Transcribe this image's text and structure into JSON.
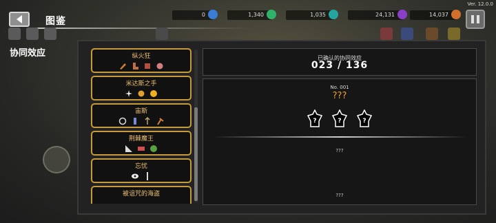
{
  "header": {
    "title": "图鉴",
    "version": "Ver. 12.0.0"
  },
  "resources": [
    {
      "name": "blue-gem",
      "value": "0",
      "color": "#3a7bd5"
    },
    {
      "name": "green-gem",
      "value": "1,340",
      "color": "#2fb36a"
    },
    {
      "name": "teal-gem",
      "value": "1,035",
      "color": "#23a6a0"
    },
    {
      "name": "purple-gem",
      "value": "24,131",
      "color": "#8a3fc8"
    },
    {
      "name": "orange-gem",
      "value": "14,037",
      "color": "#d0702a"
    }
  ],
  "section_label": "协同效应",
  "synergy_list": [
    {
      "name": "纵火狂",
      "icons": [
        "horn-icon",
        "boot-icon",
        "dice-icon",
        "meat-icon"
      ]
    },
    {
      "name": "米达斯之手",
      "icons": [
        "sparkle-icon",
        "coin-icon",
        "gold-coin-icon"
      ]
    },
    {
      "name": "宙斯",
      "icons": [
        "bolt-ring-icon",
        "figure-icon",
        "spear-icon",
        "axe-icon"
      ]
    },
    {
      "name": "荆棘魔王",
      "icons": [
        "spike-icon",
        "card-icon",
        "demon-mask-icon"
      ]
    },
    {
      "name": "忘忧",
      "icons": [
        "eye-icon",
        "blade-icon"
      ]
    },
    {
      "name": "被诅咒的海盗",
      "icons": []
    }
  ],
  "confirmed": {
    "label": "已确认的协同效应",
    "value": "023 / 136"
  },
  "detail": {
    "number": "No. 001",
    "name": "???",
    "slot_mark": "?",
    "desc_top": "???",
    "desc_bottom": "???"
  },
  "colors": {
    "card_border": "#c89a3a",
    "card_title": "#f0c070",
    "highlight": "#f0a030"
  }
}
